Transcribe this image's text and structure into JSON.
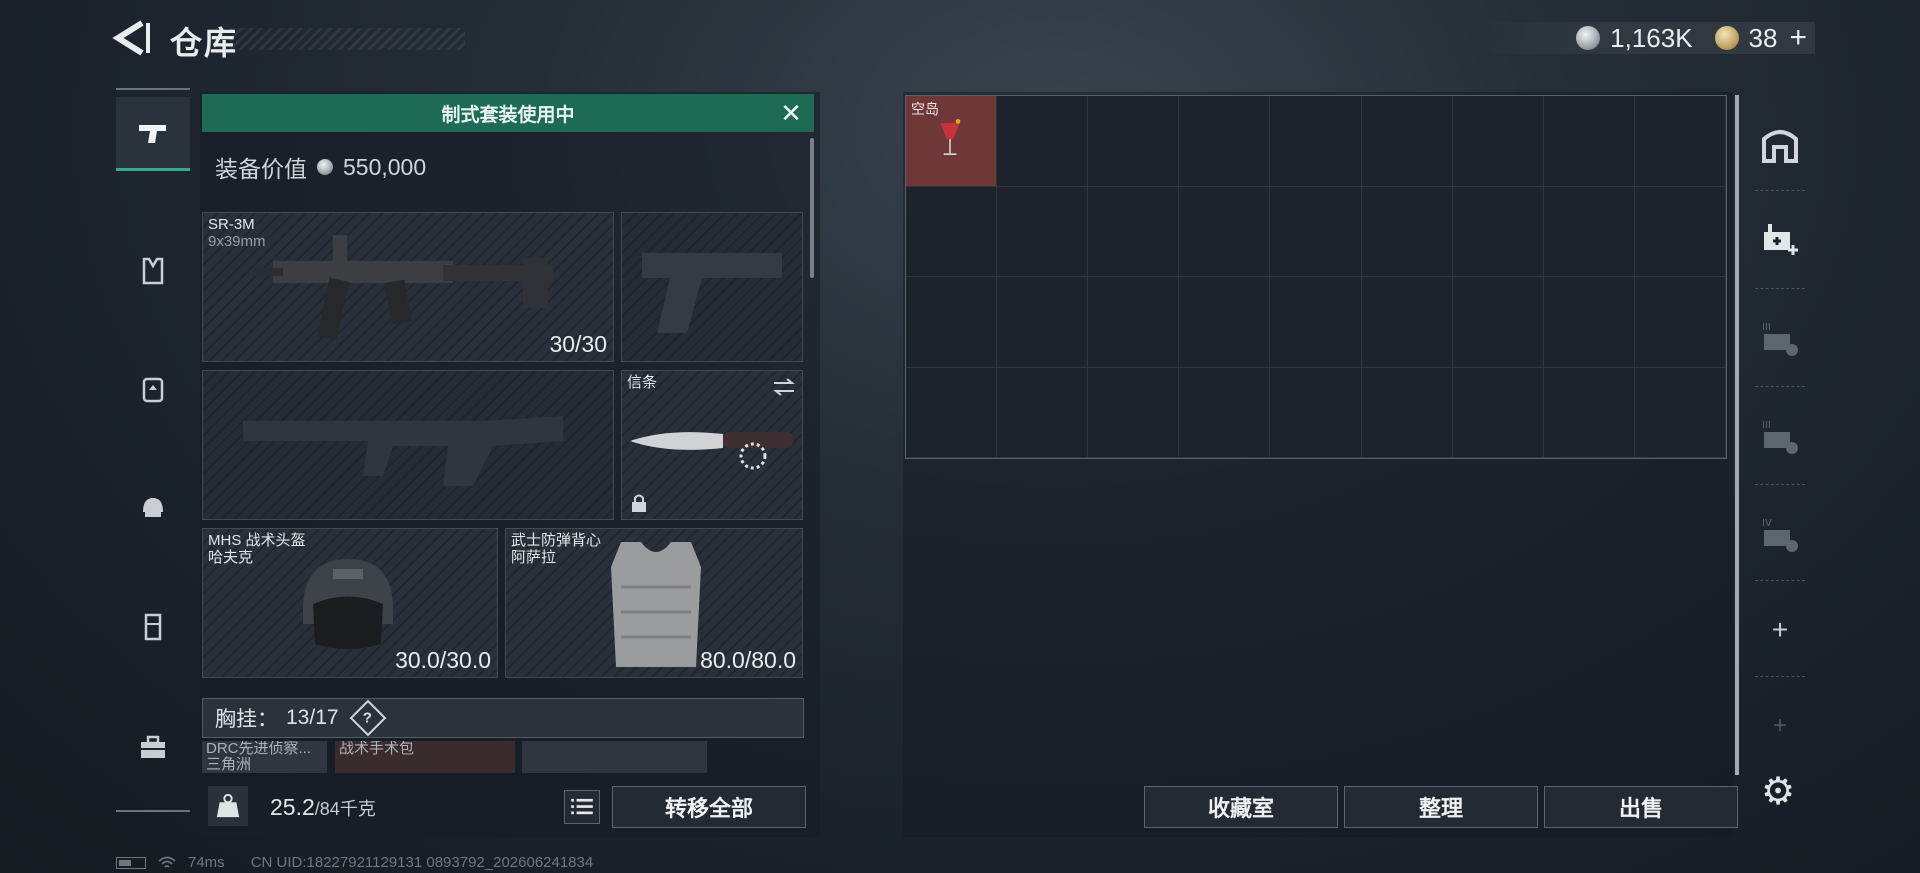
{
  "header": {
    "title": "仓库"
  },
  "currency": {
    "coins": "1,163K",
    "tickets": "38",
    "add_label": "+"
  },
  "kit": {
    "banner": "制式套装使用中",
    "close_label": "✕",
    "value_label": "装备价值",
    "value": "550,000"
  },
  "slots": {
    "primary": {
      "name": "SR-3M",
      "ammo": "9x39mm",
      "count": "30/30"
    },
    "knife": {
      "name": "信条"
    },
    "helmet": {
      "name": "MHS 战术头盔",
      "sub": "哈夫克",
      "durability": "30.0/30.0"
    },
    "armor": {
      "name": "武士防弹背心",
      "sub": "阿萨拉",
      "durability": "80.0/80.0"
    }
  },
  "chest": {
    "label": "胸挂：",
    "capacity": "13/17",
    "help": "?",
    "items": [
      "DRC先进侦察...",
      "战术手术包"
    ],
    "item_sub": "三角洲"
  },
  "weight": {
    "current": "25.2",
    "max": "/84千克",
    "transfer_label": "转移全部"
  },
  "storage": {
    "items": [
      {
        "name": "空岛"
      }
    ],
    "buttons": {
      "collection": "收藏室",
      "organize": "整理",
      "sell": "出售"
    }
  },
  "right_rail": {
    "add_label": "+"
  },
  "status_bar": {
    "ping": "74ms",
    "uid": "CN UID:18227921129131 0893792_202606241834"
  }
}
